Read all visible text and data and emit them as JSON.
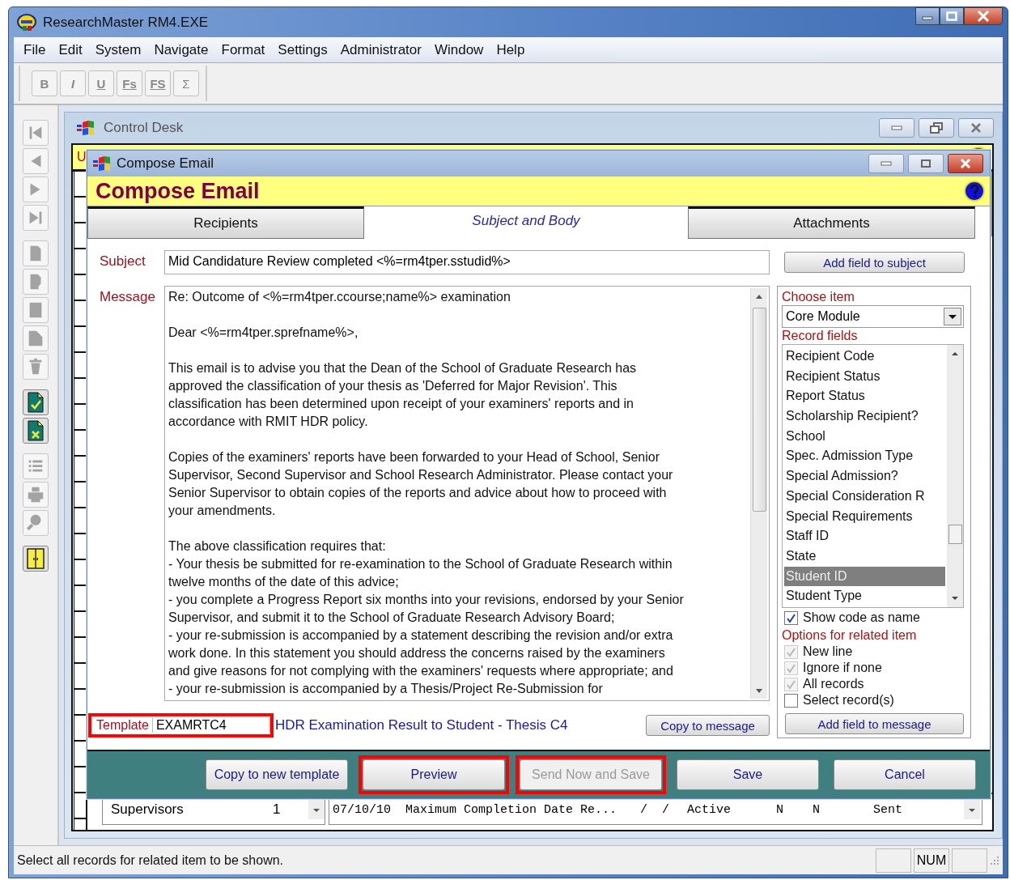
{
  "window": {
    "title": "ResearchMaster RM4.EXE"
  },
  "menu": [
    {
      "label": "File"
    },
    {
      "label": "Edit"
    },
    {
      "label": "System"
    },
    {
      "label": "Navigate"
    },
    {
      "label": "Format"
    },
    {
      "label": "Settings"
    },
    {
      "label": "Administrator"
    },
    {
      "label": "Window"
    },
    {
      "label": "Help"
    }
  ],
  "format_toolbar": [
    {
      "label": "B",
      "kind": "bold"
    },
    {
      "label": "I",
      "kind": "italic"
    },
    {
      "label": "U",
      "kind": "underline"
    },
    {
      "label": "Fs",
      "kind": "underline"
    },
    {
      "label": "FS",
      "kind": "underline"
    },
    {
      "label": "Σ",
      "kind": "plain"
    }
  ],
  "side_toolbar": [
    {
      "items": [
        {
          "kind": "first",
          "disabled": true
        },
        {
          "kind": "previous",
          "disabled": true
        },
        {
          "kind": "next",
          "disabled": true
        },
        {
          "kind": "last",
          "disabled": true
        }
      ]
    },
    {
      "items": [
        {
          "kind": "page",
          "disabled": true
        },
        {
          "kind": "page-fold",
          "disabled": true
        },
        {
          "kind": "sheet",
          "disabled": true
        },
        {
          "kind": "page-corner",
          "disabled": true
        },
        {
          "kind": "trash",
          "disabled": true
        }
      ]
    },
    {
      "items": [
        {
          "kind": "doc-check",
          "disabled": false
        },
        {
          "kind": "doc-cross",
          "disabled": false
        }
      ]
    },
    {
      "items": [
        {
          "kind": "list",
          "disabled": true
        },
        {
          "kind": "printer",
          "disabled": true
        },
        {
          "kind": "key",
          "disabled": true
        }
      ]
    },
    {
      "items": [
        {
          "kind": "door",
          "disabled": false
        }
      ]
    }
  ],
  "control_desk": {
    "title": "Control Desk",
    "banner_text": "U",
    "list_row": {
      "name": "Supervisors",
      "count": "1",
      "columns": [
        "07/10/10",
        "Maximum Completion Date Re...",
        "/  /",
        "Active",
        "N",
        "N",
        "Sent"
      ]
    }
  },
  "compose_email": {
    "title": "Compose Email",
    "heading": "Compose Email",
    "tabs": [
      {
        "label": "Recipients",
        "selected": false
      },
      {
        "label": "Subject and Body",
        "selected": true
      },
      {
        "label": "Attachments",
        "selected": false
      }
    ],
    "subject": {
      "label": "Subject",
      "value": "Mid Candidature Review completed <%=rm4tper.sstudid%>",
      "button": "Add field to subject"
    },
    "message": {
      "label": "Message",
      "paragraphs": [
        [
          "Re: Outcome of <%=rm4tper.ccourse;name%> examination"
        ],
        [
          "Dear <%=rm4tper.sprefname%>,"
        ],
        [
          "This email is to advise you that the Dean of the School of Graduate Research has",
          "approved the classification of your thesis as 'Deferred for Major Revision'. This",
          "classification has been determined upon receipt of your examiners' reports and in",
          "accordance with RMIT HDR policy."
        ],
        [
          "Copies of the examiners' reports have been forwarded to your Head of School, Senior",
          "Supervisor, Second Supervisor and School Research Administrator. Please contact your",
          "Senior Supervisor to obtain copies of the reports and advice about how to proceed with",
          "your amendments."
        ],
        [
          "The above classification requires that:",
          "- Your thesis be submitted for re-examination to the School of Graduate Research within",
          "twelve months of the date of this advice;",
          "- you complete a Progress Report six months into your revisions, endorsed by your Senior",
          "Supervisor, and submit it to the School of Graduate Research Advisory Board;",
          "- your re-submission is accompanied by a statement describing the revision and/or extra",
          "work done. In this statement you should address the concerns raised by the examiners",
          "and give reasons for not complying with the examiners' requests where appropriate; and",
          "- your re-submission is accompanied by a Thesis/Project Re-Submission for"
        ]
      ]
    },
    "field_picker": {
      "choose_label": "Choose item",
      "item": "Core Module",
      "fields_label": "Record fields",
      "fields": [
        {
          "label": "Recipient Code",
          "selected": false
        },
        {
          "label": "Recipient Status",
          "selected": false
        },
        {
          "label": "Report Status",
          "selected": false
        },
        {
          "label": "Scholarship Recipient?",
          "selected": false
        },
        {
          "label": "School",
          "selected": false
        },
        {
          "label": "Spec. Admission Type",
          "selected": false
        },
        {
          "label": "Special Admission?",
          "selected": false
        },
        {
          "label": "Special Consideration R",
          "selected": false
        },
        {
          "label": "Special Requirements",
          "selected": false
        },
        {
          "label": "Staff ID",
          "selected": false
        },
        {
          "label": "State",
          "selected": false
        },
        {
          "label": "Student ID",
          "selected": true
        },
        {
          "label": "Student Type",
          "selected": false
        }
      ],
      "show_code": {
        "label": "Show code as name",
        "checked": true,
        "disabled": false
      },
      "options_label": "Options for related item",
      "options": [
        {
          "label": "New line",
          "checked": true,
          "disabled": true
        },
        {
          "label": "Ignore if none",
          "checked": true,
          "disabled": true
        },
        {
          "label": "All records",
          "checked": true,
          "disabled": true
        },
        {
          "label": "Select record(s)",
          "checked": false,
          "disabled": false
        }
      ],
      "button": "Add field to message"
    },
    "template": {
      "label": "Template",
      "code": "EXAMRTC4",
      "description": "HDR Examination Result to Student - Thesis C4",
      "highlighted": true,
      "button": "Copy to message"
    },
    "actions": [
      {
        "label": "Copy to new template",
        "disabled": false,
        "highlighted": false
      },
      {
        "label": "Preview",
        "disabled": false,
        "highlighted": true
      },
      {
        "label": "Send Now and Save",
        "disabled": true,
        "highlighted": true
      },
      {
        "label": "Save",
        "disabled": false,
        "highlighted": false
      },
      {
        "label": "Cancel",
        "disabled": false,
        "highlighted": false
      }
    ]
  },
  "status_bar": {
    "message": "Select all records for related item to be shown.",
    "indicators": [
      "NUM"
    ]
  }
}
